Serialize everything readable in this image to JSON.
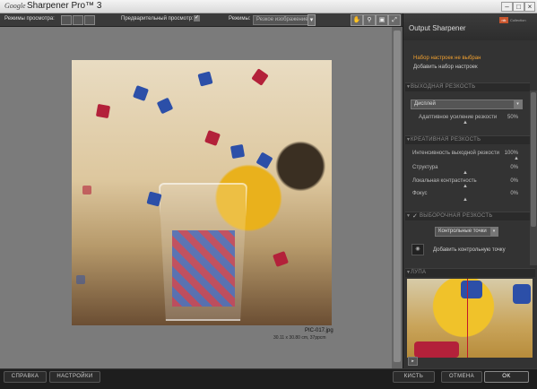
{
  "titlebar": {
    "brand": "Google",
    "app_title": "Sharpener Pro™ 3"
  },
  "toolbar": {
    "view_modes_label": "Режимы просмотра:",
    "preview_label": "Предварительный просмотр:",
    "preview_checked_glyph": "✓",
    "modes_label": "Режимы:",
    "mode_select_value": "Резкое изображение"
  },
  "image": {
    "filename": "PIC-017.jpg",
    "dimensions": "30.11 x 30.80 cm, 37ppcm"
  },
  "panel": {
    "title": "Output Sharpener",
    "logo_text": "nik",
    "logo_caption": "Collection",
    "preset_none": "Набор настроек не выбран",
    "preset_add": "Добавить набор настроек",
    "section_output": "ВЫХОДНАЯ РЕЗКОСТЬ",
    "output_dropdown": "Дисплей",
    "adaptive_label": "Адаптивное усиление резкости",
    "adaptive_value": "50%",
    "section_creative": "КРЕАТИВНАЯ РЕЗКОСТЬ",
    "creative_sliders": [
      {
        "label": "Интенсивность выходной резкости",
        "value": "100%"
      },
      {
        "label": "Структура",
        "value": "0%"
      },
      {
        "label": "Локальная контрастность",
        "value": "0%"
      },
      {
        "label": "Фокус",
        "value": "0%"
      }
    ],
    "section_selective": "ВЫБОРОЧНАЯ РЕЗКОСТЬ",
    "selective_check_glyph": "✓",
    "control_points_dropdown": "Контрольные точки",
    "add_control_point": "Добавить контрольную точку",
    "section_loupe": "ЛУПА"
  },
  "bottom": {
    "help": "СПРАВКА",
    "settings": "НАСТРОЙКИ",
    "brush": "КИСТЬ",
    "cancel": "ОТМЕНА",
    "ok": "OK"
  }
}
